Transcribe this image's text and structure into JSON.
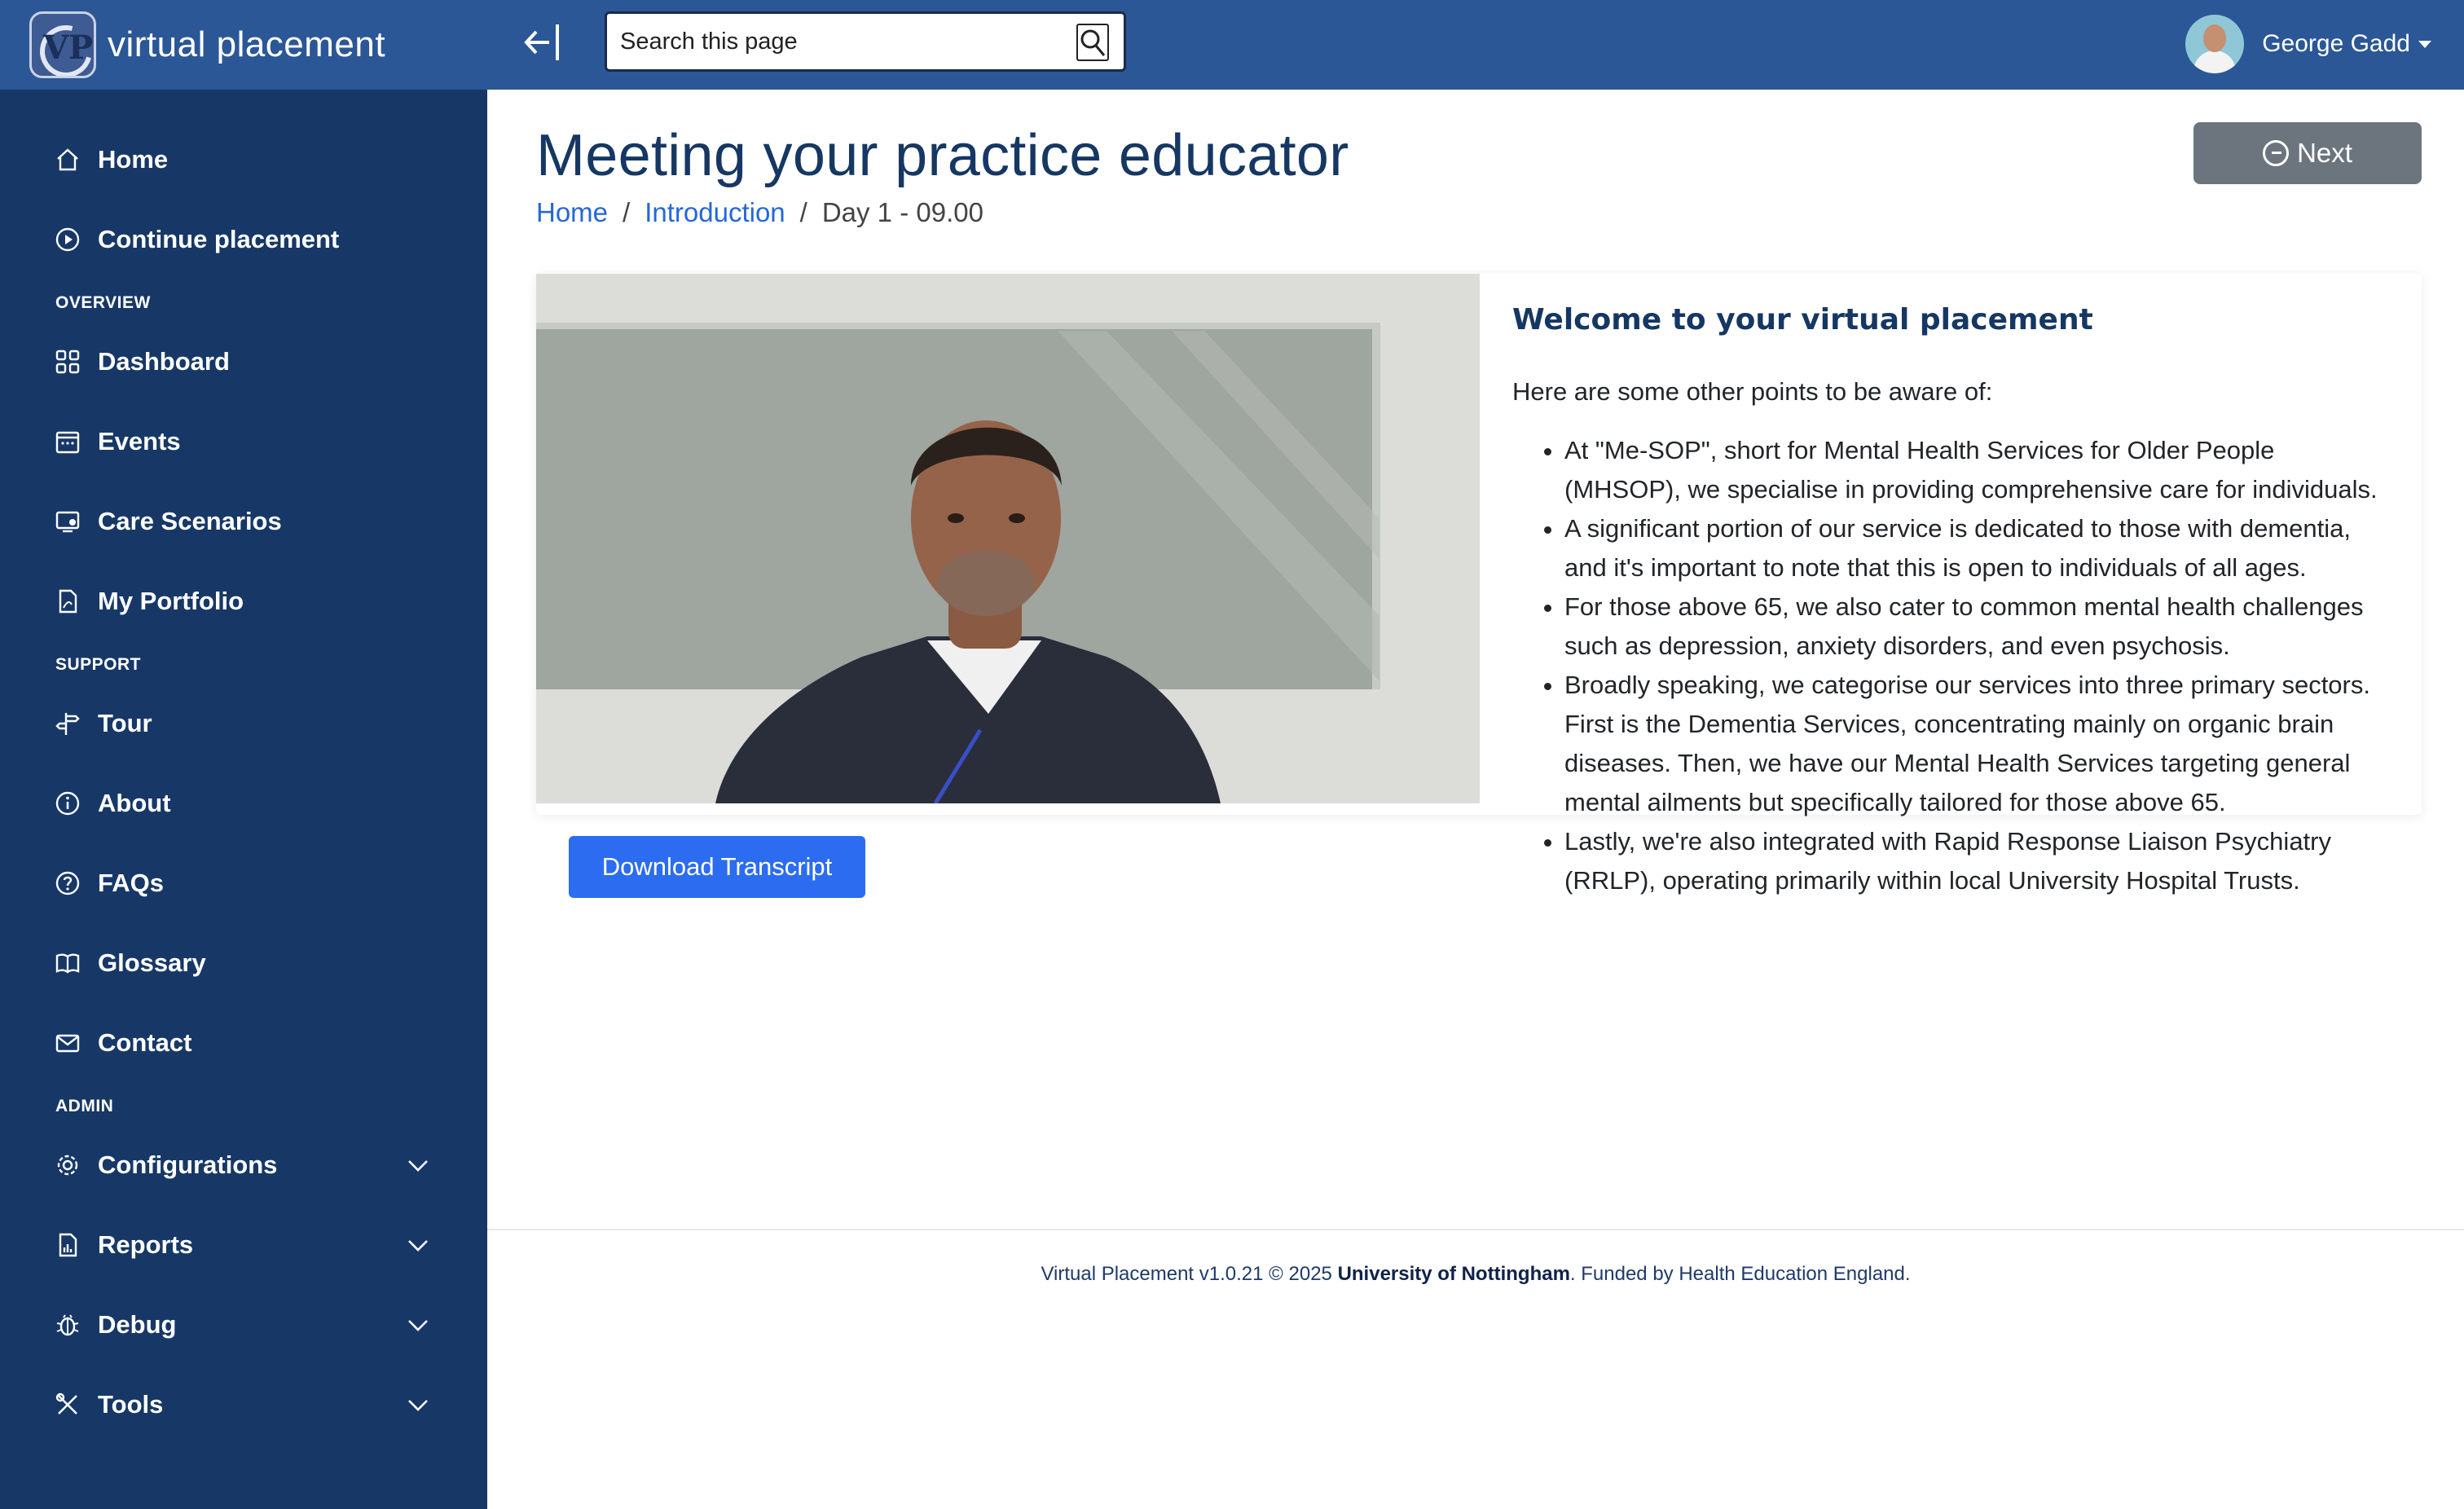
{
  "app": {
    "brand": "virtual placement",
    "logo_letters": "VP"
  },
  "search": {
    "placeholder": "Search this page"
  },
  "user": {
    "name": "George Gadd"
  },
  "sidebar": {
    "items": [
      {
        "label": "Home",
        "icon": "home-icon"
      },
      {
        "label": "Continue placement",
        "icon": "play-circle-icon"
      },
      {
        "label": "Dashboard",
        "icon": "grid-icon"
      },
      {
        "label": "Events",
        "icon": "calendar-icon"
      },
      {
        "label": "Care Scenarios",
        "icon": "monitor-person-icon"
      },
      {
        "label": "My Portfolio",
        "icon": "pdf-file-icon"
      },
      {
        "label": "Tour",
        "icon": "signpost-icon"
      },
      {
        "label": "About",
        "icon": "info-icon"
      },
      {
        "label": "FAQs",
        "icon": "question-icon"
      },
      {
        "label": "Glossary",
        "icon": "book-icon"
      },
      {
        "label": "Contact",
        "icon": "envelope-icon"
      },
      {
        "label": "Configurations",
        "icon": "gear-icon"
      },
      {
        "label": "Reports",
        "icon": "report-icon"
      },
      {
        "label": "Debug",
        "icon": "bug-icon"
      },
      {
        "label": "Tools",
        "icon": "tools-icon"
      }
    ],
    "sections": {
      "overview": "OVERVIEW",
      "support": "SUPPORT",
      "admin": "ADMIN"
    }
  },
  "page": {
    "title": "Meeting your practice educator",
    "next_label": "Next",
    "breadcrumb": {
      "home": "Home",
      "introduction": "Introduction",
      "current": "Day 1 - 09.00",
      "separator": "/"
    }
  },
  "content": {
    "download_label": "Download Transcript",
    "heading": "Welcome to your virtual placement",
    "intro": "Here are some other points to be aware of:",
    "points": [
      "At \"Me-SOP\", short for Mental Health Services for Older People (MHSOP), we specialise in providing comprehensive care for individuals.",
      "A significant portion of our service is dedicated to those with dementia, and it's important to note that this is open to individuals of all ages.",
      "For those above 65, we also cater to common mental health challenges such as depression, anxiety disorders, and even psychosis.",
      "Broadly speaking, we categorise our services into three primary sectors. First is the Dementia Services, concentrating mainly on organic brain diseases. Then, we have our Mental Health Services targeting general mental ailments but specifically tailored for those above 65.",
      "Lastly, we're also integrated with Rapid Response Liaison Psychiatry (RRLP), operating primarily within local University Hospital Trusts."
    ]
  },
  "footer": {
    "prefix": "Virtual Placement v1.0.21 © 2025 ",
    "org": "University of Nottingham",
    "suffix": ". Funded by Health Education England."
  },
  "colors": {
    "topbar": "#2b5797",
    "sidebar": "#173867",
    "primary_button": "#2b6cf0",
    "secondary_button": "#6c757d",
    "title": "#163763"
  }
}
